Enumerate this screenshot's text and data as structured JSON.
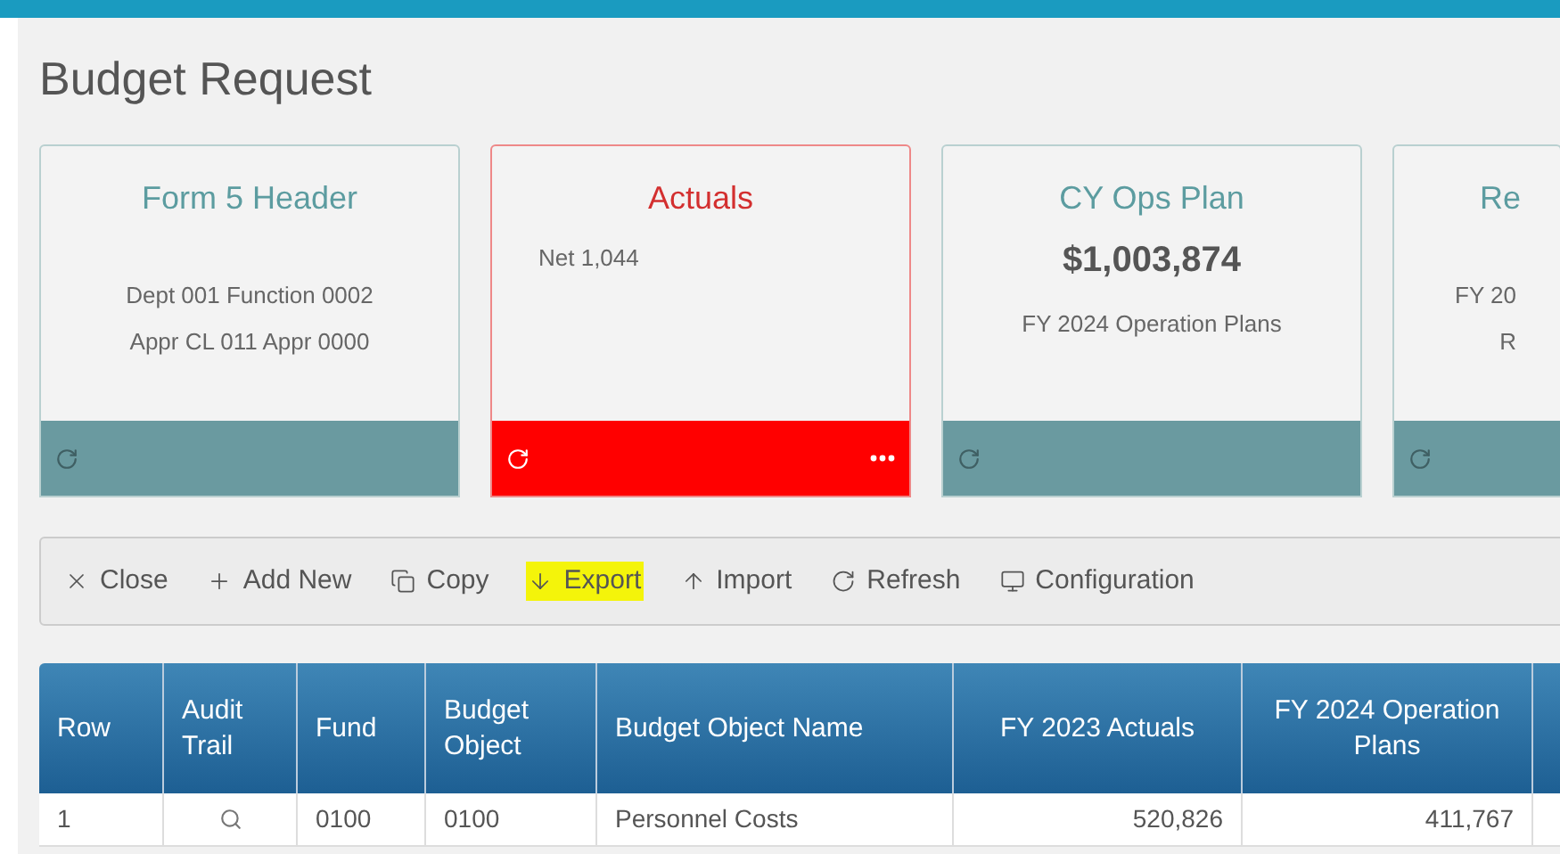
{
  "page": {
    "title": "Budget Request"
  },
  "cards": [
    {
      "kind": "normal",
      "title": "Form 5 Header",
      "lines": [
        "Dept 001 Function 0002",
        "Appr CL 011 Appr 0000"
      ],
      "more": false
    },
    {
      "kind": "alert",
      "title": "Actuals",
      "note": "Net 1,044",
      "more": true
    },
    {
      "kind": "normal",
      "title": "CY Ops Plan",
      "amount": "$1,003,874",
      "lines": [
        "FY 2024 Operation Plans"
      ],
      "more": false
    },
    {
      "kind": "clipped",
      "title": "Re",
      "lines": [
        "FY 20",
        "R"
      ],
      "more": false
    }
  ],
  "toolbar": [
    {
      "kind": "close",
      "label": "Close",
      "highlighted": false
    },
    {
      "kind": "add",
      "label": "Add New",
      "highlighted": false
    },
    {
      "kind": "copy",
      "label": "Copy",
      "highlighted": false
    },
    {
      "kind": "export",
      "label": "Export",
      "highlighted": true
    },
    {
      "kind": "import",
      "label": "Import",
      "highlighted": false
    },
    {
      "kind": "refresh",
      "label": "Refresh",
      "highlighted": false
    },
    {
      "kind": "config",
      "label": "Configuration",
      "highlighted": false
    }
  ],
  "table": {
    "columns": [
      "Row",
      "Audit Trail",
      "Fund",
      "Budget Object",
      "Budget Object Name",
      "FY 2023 Actuals",
      "FY 2024 Operation Plans"
    ],
    "rows": [
      {
        "cells": [
          "1",
          "",
          "0100",
          "0100",
          "Personnel Costs",
          "520,826",
          "411,767"
        ]
      }
    ]
  }
}
